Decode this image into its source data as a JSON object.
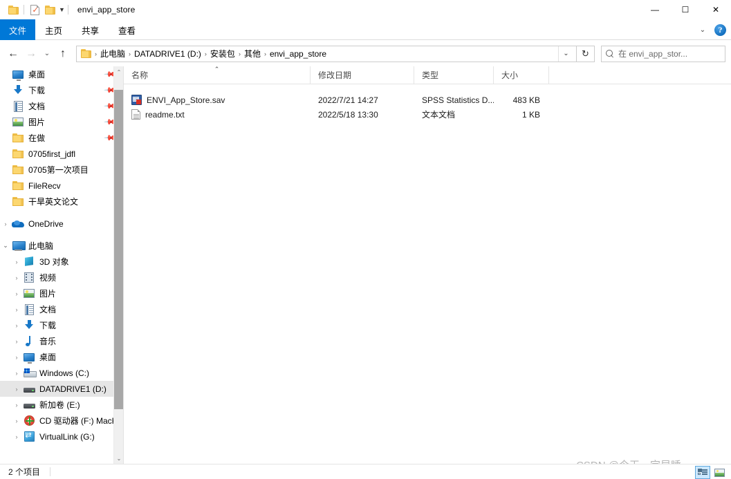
{
  "window": {
    "title": "envi_app_store",
    "quick_access": [
      {
        "name": "folder-icon",
        "label": ""
      },
      {
        "name": "properties-icon",
        "label": ""
      },
      {
        "name": "new-folder-icon",
        "label": ""
      }
    ],
    "controls": {
      "minimize": "—",
      "maximize": "☐",
      "close": "✕"
    }
  },
  "ribbon": {
    "tabs": [
      {
        "label": "文件",
        "active": true
      },
      {
        "label": "主页",
        "active": false
      },
      {
        "label": "共享",
        "active": false
      },
      {
        "label": "查看",
        "active": false
      }
    ],
    "collapse_chevron": "⌄",
    "help_label": "?",
    "accent_color": "#0078d7"
  },
  "address": {
    "back": "←",
    "forward": "→",
    "recent": "⌄",
    "up": "↑",
    "breadcrumbs": [
      "此电脑",
      "DATADRIVE1 (D:)",
      "安装包",
      "其他",
      "envi_app_store"
    ],
    "separator": "›",
    "dropdown": "⌄",
    "refresh": "↻",
    "search_text": "在 envi_app_stor...",
    "search_placeholder": "在 envi_app_store 中搜索"
  },
  "sidebar": {
    "quick_access": [
      {
        "label": "桌面",
        "icon": "desktop-icon",
        "pinned": true,
        "expander": ""
      },
      {
        "label": "下载",
        "icon": "download-icon",
        "pinned": true,
        "expander": ""
      },
      {
        "label": "文档",
        "icon": "documents-icon",
        "pinned": true,
        "expander": ""
      },
      {
        "label": "图片",
        "icon": "pictures-icon",
        "pinned": true,
        "expander": ""
      },
      {
        "label": "在做",
        "icon": "folder-icon",
        "pinned": true,
        "expander": ""
      },
      {
        "label": "0705first_jdfl",
        "icon": "folder-icon",
        "pinned": false,
        "expander": ""
      },
      {
        "label": "0705第一次项目",
        "icon": "folder-icon",
        "pinned": false,
        "expander": ""
      },
      {
        "label": "FileRecv",
        "icon": "folder-icon",
        "pinned": false,
        "expander": ""
      },
      {
        "label": "干旱英文论文",
        "icon": "folder-icon",
        "pinned": false,
        "expander": ""
      }
    ],
    "onedrive": {
      "label": "OneDrive",
      "icon": "onedrive-icon",
      "expander": "›"
    },
    "this_pc": {
      "label": "此电脑",
      "icon": "this-pc-icon",
      "expander": "⌄"
    },
    "pc_children": [
      {
        "label": "3D 对象",
        "icon": "3d-objects-icon",
        "expander": "›",
        "selected": false
      },
      {
        "label": "视频",
        "icon": "videos-icon",
        "expander": "›",
        "selected": false
      },
      {
        "label": "图片",
        "icon": "pictures-icon",
        "expander": "›",
        "selected": false
      },
      {
        "label": "文档",
        "icon": "documents-icon",
        "expander": "›",
        "selected": false
      },
      {
        "label": "下载",
        "icon": "download-icon",
        "expander": "›",
        "selected": false
      },
      {
        "label": "音乐",
        "icon": "music-icon",
        "expander": "›",
        "selected": false
      },
      {
        "label": "桌面",
        "icon": "desktop-icon",
        "expander": "›",
        "selected": false
      },
      {
        "label": "Windows  (C:)",
        "icon": "windows-drive-icon",
        "expander": "›",
        "selected": false
      },
      {
        "label": "DATADRIVE1 (D:)",
        "icon": "drive-icon",
        "expander": "›",
        "selected": true
      },
      {
        "label": "新加卷 (E:)",
        "icon": "drive-icon",
        "expander": "›",
        "selected": false
      },
      {
        "label": "CD 驱动器 (F:) MacKM",
        "icon": "cd-drive-icon",
        "expander": "›",
        "selected": false
      },
      {
        "label": "VirtualLink (G:)",
        "icon": "virtuallink-icon",
        "expander": "›",
        "selected": false
      }
    ],
    "scroll_up": "⌃",
    "scroll_down": "⌄"
  },
  "filelist": {
    "columns": [
      {
        "label": "名称",
        "sorted": true,
        "caret": "⌃"
      },
      {
        "label": "修改日期",
        "sorted": false,
        "caret": ""
      },
      {
        "label": "类型",
        "sorted": false,
        "caret": ""
      },
      {
        "label": "大小",
        "sorted": false,
        "caret": ""
      }
    ],
    "rows": [
      {
        "name": "ENVI_App_Store.sav",
        "icon": "spss-data-file-icon",
        "date": "2022/7/21 14:27",
        "type": "SPSS Statistics D...",
        "size": "483 KB"
      },
      {
        "name": "readme.txt",
        "icon": "text-file-icon",
        "date": "2022/5/18 13:30",
        "type": "文本文档",
        "size": "1 KB"
      }
    ]
  },
  "statusbar": {
    "item_count": "2 个项目",
    "view_details": "",
    "view_large_icons": ""
  },
  "watermark": "CSDN @今天一定早睡"
}
